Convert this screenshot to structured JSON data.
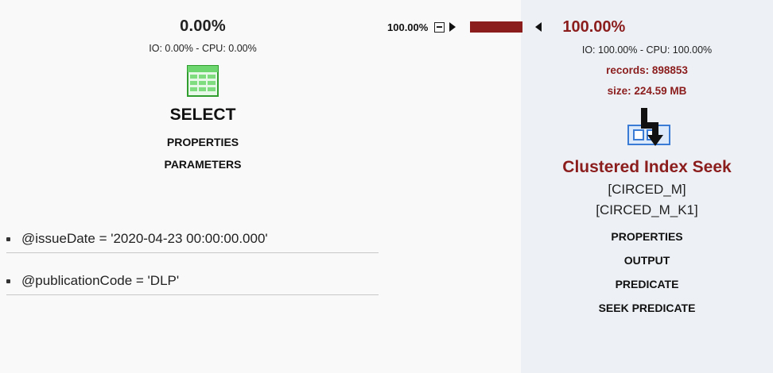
{
  "select_node": {
    "cost_pct": "0.00%",
    "io_cpu": "IO: 0.00% - CPU: 0.00%",
    "icon": "table-grid-icon",
    "title": "SELECT",
    "links": [
      "PROPERTIES",
      "PARAMETERS"
    ]
  },
  "parameters": [
    "@issueDate = '2020-04-23 00:00:00.000'",
    "@publicationCode = 'DLP'"
  ],
  "connector": {
    "pct_label": "100.00%",
    "bar_color": "#8b1d1d"
  },
  "seek_node": {
    "cost_pct": "100.00%",
    "io_cpu": "IO: 100.00% - CPU: 100.00%",
    "records": "records: 898853",
    "size": "size: 224.59 MB",
    "icon": "clustered-index-seek-icon",
    "title": "Clustered Index Seek",
    "table": "[CIRCED_M]",
    "index": "[CIRCED_M_K1]",
    "links": [
      "PROPERTIES",
      "OUTPUT",
      "PREDICATE",
      "SEEK PREDICATE"
    ]
  },
  "colors": {
    "accent_red": "#8b1d1d",
    "panel_bg": "#edf1f6",
    "icon_green": "#5fd35f",
    "icon_blue": "#3a7bd5"
  }
}
